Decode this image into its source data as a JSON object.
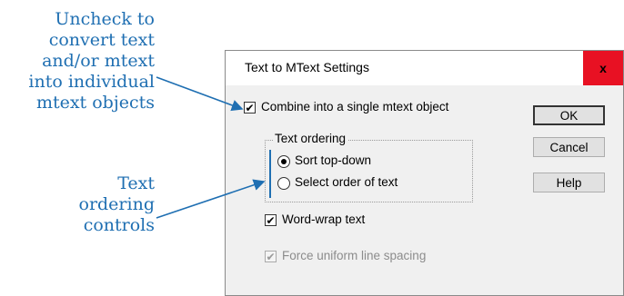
{
  "annotations": {
    "callout1_lines": [
      "Uncheck to",
      "convert text",
      "and/or mtext",
      "into individual",
      "mtext objects"
    ],
    "callout2_lines": [
      "Text",
      "ordering",
      "controls"
    ],
    "color": "#1f6fb2"
  },
  "dialog": {
    "title": "Text to MText Settings",
    "close_label": "x",
    "close_color": "#e81123",
    "combine_checkbox": {
      "label": "Combine into a single mtext object",
      "checked": true
    },
    "ordering_group": {
      "label": "Text ordering",
      "options": [
        {
          "label": "Sort top-down",
          "selected": true
        },
        {
          "label": "Select order of text",
          "selected": false
        }
      ]
    },
    "wordwrap_checkbox": {
      "label": "Word-wrap text",
      "checked": true
    },
    "uniform_spacing_checkbox": {
      "label": "Force uniform line spacing",
      "checked": true,
      "disabled": true
    },
    "buttons": {
      "ok": "OK",
      "cancel": "Cancel",
      "help": "Help"
    }
  }
}
